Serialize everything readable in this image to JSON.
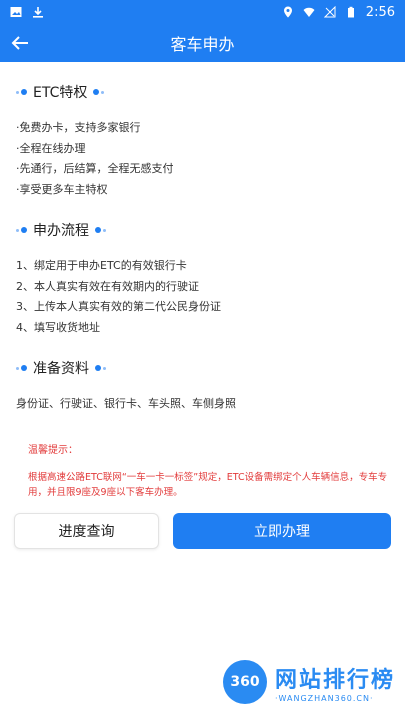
{
  "status_bar": {
    "time": "2:56",
    "icons": [
      "image-icon",
      "download-icon",
      "location-icon",
      "wifi-icon",
      "signal-off-icon",
      "battery-icon"
    ]
  },
  "app_bar": {
    "title": "客车申办",
    "back_icon": "arrow-left-icon"
  },
  "sections": [
    {
      "title": "ETC特权",
      "lines": [
        "·免费办卡，支持多家银行",
        "·全程在线办理",
        "·先通行，后结算，全程无感支付",
        "·享受更多车主特权"
      ]
    },
    {
      "title": "申办流程",
      "lines": [
        "1、绑定用于申办ETC的有效银行卡",
        "2、本人真实有效在有效期内的行驶证",
        "3、上传本人真实有效的第二代公民身份证",
        "4、填写收货地址"
      ]
    },
    {
      "title": "准备资料",
      "lines": [
        "身份证、行驶证、银行卡、车头照、车侧身照"
      ]
    }
  ],
  "tip": {
    "title": "温馨提示：",
    "body": "根据高速公路ETC联网“一车一卡一标签”规定，ETC设备需绑定个人车辆信息，专车专用，并且限9座及9座以下客车办理。"
  },
  "buttons": {
    "progress": "进度查询",
    "apply": "立即办理"
  },
  "watermark": {
    "badge": "360",
    "title": "网站排行榜",
    "subtitle": "·WANGZHAN360.CN·"
  },
  "colors": {
    "primary": "#1f7ef2",
    "tip": "#e23b3b"
  }
}
